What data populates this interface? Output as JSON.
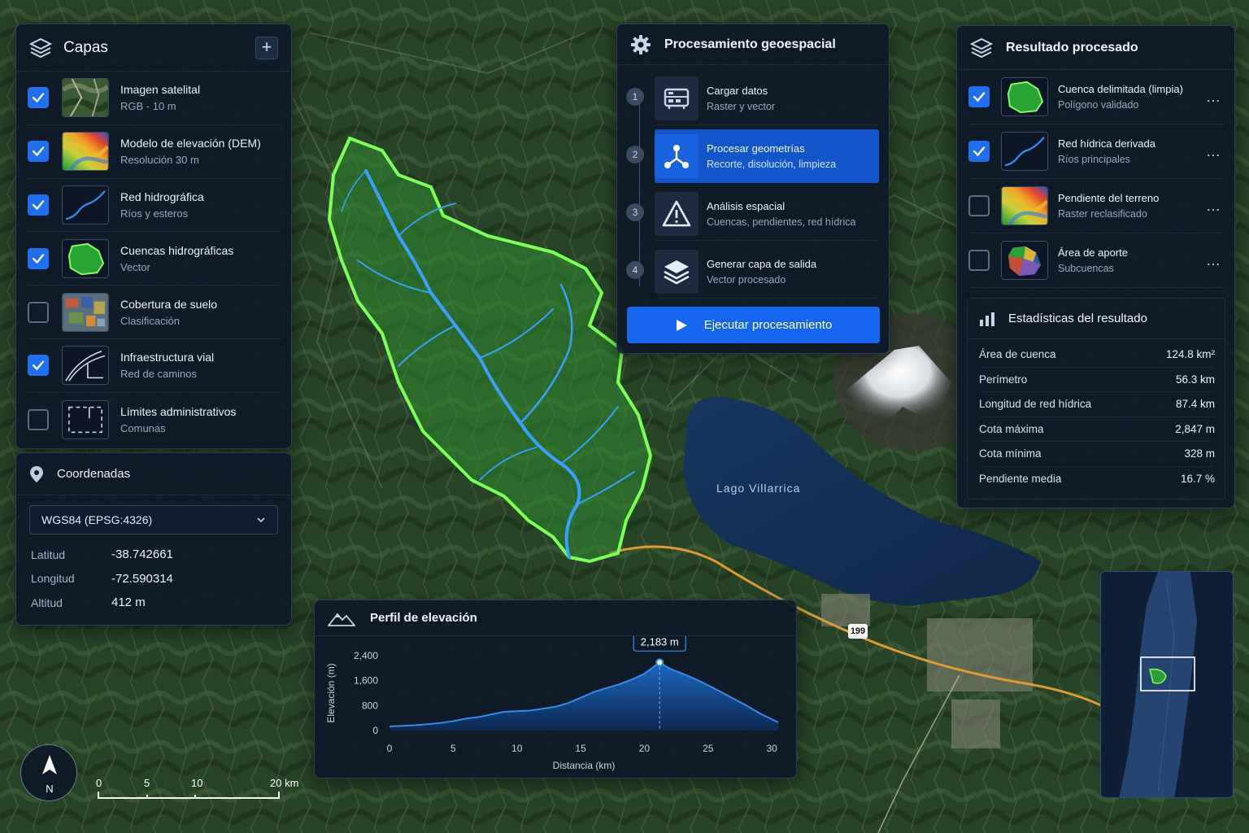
{
  "map": {
    "lake_label": "Lago Villarrica",
    "road_label": "199",
    "compass_label": "N",
    "scale_labels": [
      "0",
      "5",
      "10",
      "20 km"
    ]
  },
  "layers": {
    "title": "Capas",
    "add_label": "+",
    "items": [
      {
        "name": "Imagen satelital",
        "sub": "RGB - 10 m",
        "checked": true,
        "thumb": "satellite-image-thumbnail"
      },
      {
        "name": "Modelo de elevación (DEM)",
        "sub": "Resolución 30 m",
        "checked": true,
        "thumb": "dem-heatmap-thumbnail"
      },
      {
        "name": "Red hidrográfica",
        "sub": "Ríos y esteros",
        "checked": true,
        "thumb": "river-line-thumbnail"
      },
      {
        "name": "Cuencas hidrográficas",
        "sub": "Vector",
        "checked": true,
        "thumb": "basin-polygon-thumbnail"
      },
      {
        "name": "Cobertura de suelo",
        "sub": "Clasificación",
        "checked": false,
        "thumb": "land-cover-thumbnail"
      },
      {
        "name": "Infraestructura vial",
        "sub": "Red de caminos",
        "checked": true,
        "thumb": "road-network-thumbnail"
      },
      {
        "name": "Límites administrativos",
        "sub": "Comunas",
        "checked": false,
        "thumb": "admin-boundary-thumbnail"
      }
    ]
  },
  "coords": {
    "title": "Coordenadas",
    "crs": "WGS84 (EPSG:4326)",
    "rows": [
      {
        "label": "Latitud",
        "value": "-38.742661"
      },
      {
        "label": "Longitud",
        "value": "-72.590314"
      },
      {
        "label": "Altitud",
        "value": "412 m"
      }
    ]
  },
  "processing": {
    "title": "Procesamiento geoespacial",
    "steps": [
      {
        "num": "1",
        "name": "Cargar datos",
        "sub": "Raster y vector",
        "active": false,
        "icon": "server-icon"
      },
      {
        "num": "2",
        "name": "Procesar geometrías",
        "sub": "Recorte, disolución, limpieza",
        "active": true,
        "icon": "geometry-nodes-icon"
      },
      {
        "num": "3",
        "name": "Análisis espacial",
        "sub": "Cuencas, pendientes, red hídrica",
        "active": false,
        "icon": "warning-triangle-icon"
      },
      {
        "num": "4",
        "name": "Generar capa de salida",
        "sub": "Vector procesado",
        "active": false,
        "icon": "layers-icon"
      }
    ],
    "run_label": "Ejecutar procesamiento"
  },
  "result": {
    "title": "Resultado procesado",
    "items": [
      {
        "name": "Cuenca delimitada (limpia)",
        "sub": "Polígono validado",
        "checked": true,
        "thumb": "basin-polygon-thumbnail"
      },
      {
        "name": "Red hídrica derivada",
        "sub": "Ríos principales",
        "checked": true,
        "thumb": "river-line-thumbnail"
      },
      {
        "name": "Pendiente del terreno",
        "sub": "Raster reclasificado",
        "checked": false,
        "thumb": "slope-heatmap-thumbnail"
      },
      {
        "name": "Área de aporte",
        "sub": "Subcuencas",
        "checked": false,
        "thumb": "subbasins-thumbnail"
      }
    ],
    "more_label": "…",
    "stats_title": "Estadísticas del resultado",
    "stats": [
      {
        "label": "Área de cuenca",
        "value": "124.8 km²"
      },
      {
        "label": "Perímetro",
        "value": "56.3 km"
      },
      {
        "label": "Longitud de red hídrica",
        "value": "87.4 km"
      },
      {
        "label": "Cota máxima",
        "value": "2,847 m"
      },
      {
        "label": "Cota mínima",
        "value": "328 m"
      },
      {
        "label": "Pendiente media",
        "value": "16.7 %"
      }
    ]
  },
  "profile": {
    "title": "Perfil de elevación",
    "tooltip": "2,183 m",
    "colors": {
      "line": "#2f8df0",
      "fill_top": "#1e6fd1",
      "fill_bottom": "#0c2a55"
    }
  },
  "chart_data": {
    "type": "area",
    "xlabel": "Distancia (km)",
    "ylabel": "Elevación (m)",
    "xlim": [
      0,
      30.5
    ],
    "ylim": [
      0,
      2400
    ],
    "xticks": [
      0,
      5,
      10,
      15,
      20,
      25,
      30
    ],
    "yticks": [
      0,
      800,
      1600,
      2400
    ],
    "xtick_labels": [
      "0",
      "5",
      "10",
      "15",
      "20",
      "25",
      "30"
    ],
    "ytick_labels": [
      "0",
      "800",
      "1,600",
      "2,400"
    ],
    "highlight": {
      "x": 21.2,
      "y": 2183
    },
    "series": [
      {
        "x": [
          0,
          1,
          2,
          3,
          4,
          5,
          6,
          7,
          8,
          9,
          10,
          11,
          12,
          13,
          14,
          15,
          16,
          17,
          18,
          19,
          20,
          21.2,
          22,
          23,
          24,
          25,
          26,
          27,
          28,
          29,
          30.5
        ],
        "values": [
          130,
          150,
          170,
          200,
          240,
          300,
          380,
          430,
          520,
          600,
          620,
          640,
          700,
          760,
          880,
          1050,
          1230,
          1360,
          1480,
          1630,
          1820,
          2183,
          1980,
          1820,
          1650,
          1450,
          1240,
          1020,
          800,
          560,
          260
        ]
      }
    ]
  }
}
